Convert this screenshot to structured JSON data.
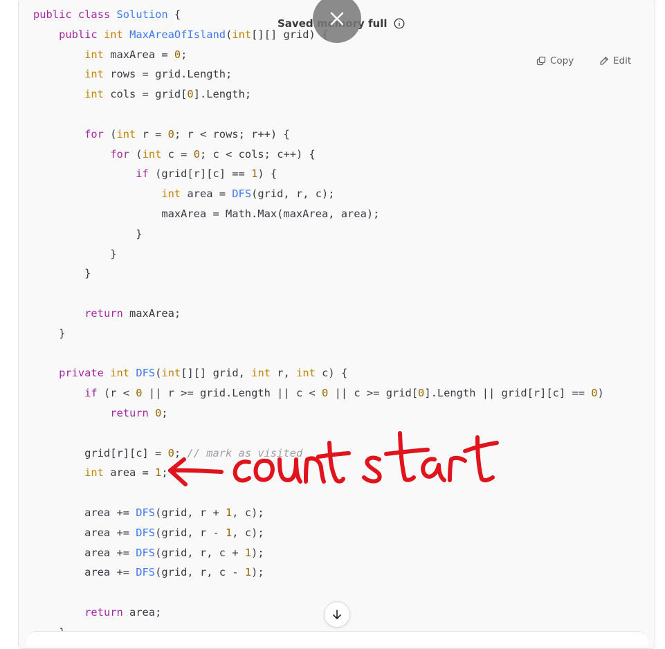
{
  "code": {
    "lines": [
      "public class Solution {",
      "    public int MaxAreaOfIsland(int[][] grid) {",
      "        int maxArea = 0;",
      "        int rows = grid.Length;",
      "        int cols = grid[0].Length;",
      "",
      "        for (int r = 0; r < rows; r++) {",
      "            for (int c = 0; c < cols; c++) {",
      "                if (grid[r][c] == 1) {",
      "                    int area = DFS(grid, r, c);",
      "                    maxArea = Math.Max(maxArea, area);",
      "                }",
      "            }",
      "        }",
      "",
      "        return maxArea;",
      "    }",
      "",
      "    private int DFS(int[][] grid, int r, int c) {",
      "        if (r < 0 || r >= grid.Length || c < 0 || c >= grid[0].Length || grid[r][c] == 0)",
      "            return 0;",
      "",
      "        grid[r][c] = 0; // mark as visited",
      "        int area = 1;",
      "",
      "        area += DFS(grid, r + 1, c);",
      "        area += DFS(grid, r - 1, c);",
      "        area += DFS(grid, r, c + 1);",
      "        area += DFS(grid, r, c - 1);",
      "",
      "        return area;",
      "    }"
    ]
  },
  "toolbar": {
    "copy_label": "Copy",
    "edit_label": "Edit"
  },
  "notification": {
    "text": "Saved memory full"
  },
  "annotation": {
    "text": "count start",
    "color": "#e0141c"
  },
  "icons": {
    "copy": "copy-icon",
    "edit": "pencil-icon",
    "info": "info-icon",
    "close": "close-icon",
    "scroll": "arrow-down-icon"
  }
}
